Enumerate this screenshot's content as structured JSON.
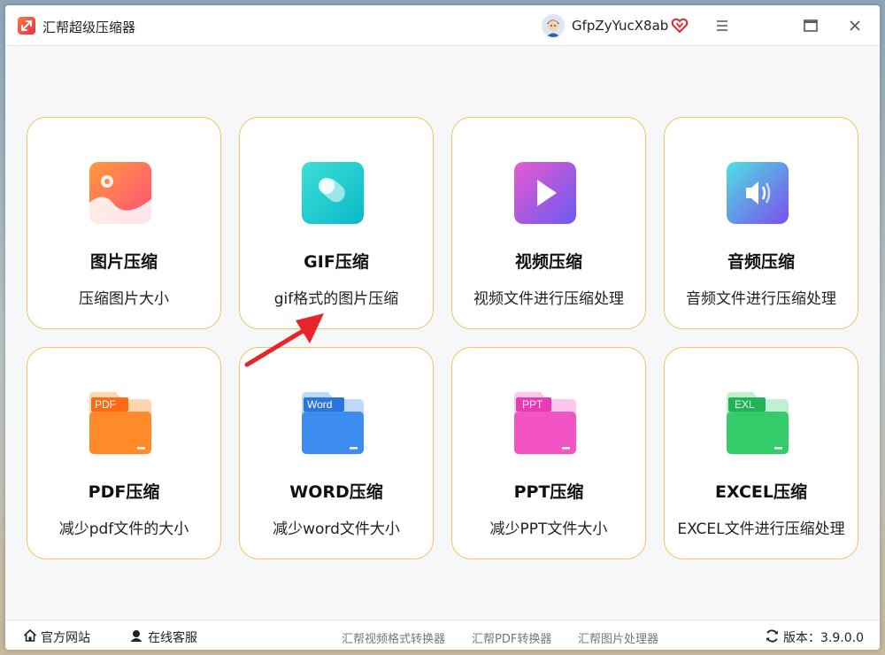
{
  "app": {
    "title": "汇帮超级压缩器"
  },
  "user": {
    "name": "GfpZyYucX8ab"
  },
  "colors": {
    "card_border": "#f3c35a",
    "arrow": "#e8242a",
    "background": "#f6f7f9"
  },
  "cards": [
    {
      "title": "图片压缩",
      "desc": "压缩图片大小",
      "icon": "image-icon"
    },
    {
      "title": "GIF压缩",
      "desc": "gif格式的图片压缩",
      "icon": "gif-icon"
    },
    {
      "title": "视频压缩",
      "desc": "视频文件进行压缩处理",
      "icon": "play-icon"
    },
    {
      "title": "音频压缩",
      "desc": "音频文件进行压缩处理",
      "icon": "speaker-icon"
    },
    {
      "title": "PDF压缩",
      "desc": "减少pdf文件的大小",
      "icon": "pdf-folder-icon",
      "badge": "PDF"
    },
    {
      "title": "WORD压缩",
      "desc": "减少word文件大小",
      "icon": "word-folder-icon",
      "badge": "Word"
    },
    {
      "title": "PPT压缩",
      "desc": "减少PPT文件大小",
      "icon": "ppt-folder-icon",
      "badge": "PPT"
    },
    {
      "title": "EXCEL压缩",
      "desc": "EXCEL文件进行压缩处理",
      "icon": "excel-folder-icon",
      "badge": "EXL"
    }
  ],
  "statusbar": {
    "website": "官方网站",
    "support": "在线客服",
    "links": [
      "汇帮视频格式转换器",
      "汇帮PDF转换器",
      "汇帮图片处理器"
    ],
    "version": "版本：3.9.0.0"
  }
}
